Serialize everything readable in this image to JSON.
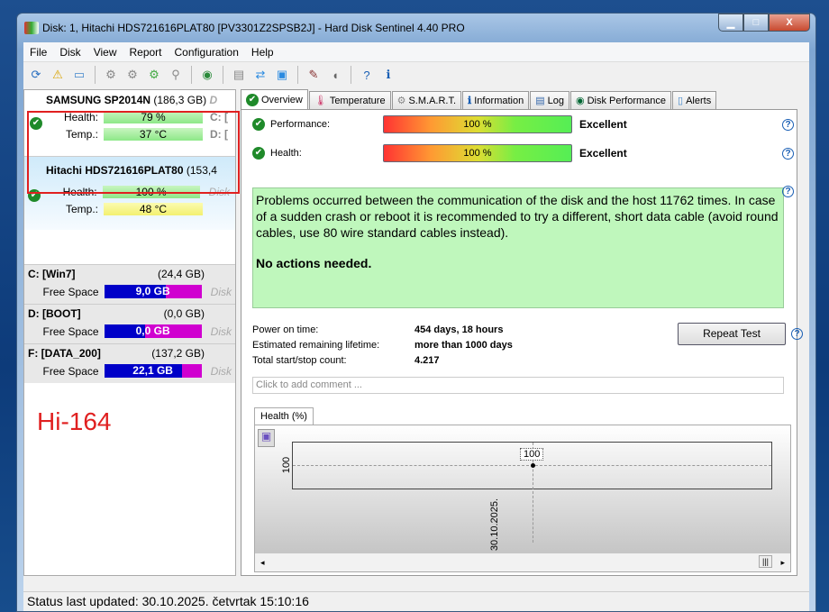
{
  "window": {
    "title": "Disk: 1, Hitachi HDS721616PLAT80 [PV3301Z2SPSB2J]  -  Hard Disk Sentinel 4.40 PRO",
    "min": "▁",
    "max": "□",
    "close": "X"
  },
  "menu": [
    "File",
    "Disk",
    "View",
    "Report",
    "Configuration",
    "Help"
  ],
  "disks": [
    {
      "name": "SAMSUNG SP2014N",
      "size": "(186,3 GB)",
      "health_label": "Health:",
      "health": "79 %",
      "health_pct": 79,
      "temp_label": "Temp.:",
      "temp": "37 °C",
      "side1": "C: [",
      "side2": "D: [",
      "tail": "D"
    },
    {
      "name": "Hitachi HDS721616PLAT80",
      "size": "(153,4",
      "health_label": "Health:",
      "health": "100 %",
      "health_pct": 100,
      "temp_label": "Temp.:",
      "temp": "48 °C",
      "side1": "Disk"
    }
  ],
  "volumes": [
    {
      "name": "C: [Win7]",
      "size": "(24,4 GB)",
      "label": "Free Space",
      "free": "9,0 GB",
      "used_pct": 63,
      "side": "Disk"
    },
    {
      "name": "D: [BOOT]",
      "size": "(0,0 GB)",
      "label": "Free Space",
      "free": "0,0 GB",
      "used_pct": 42,
      "side": "Disk"
    },
    {
      "name": "F: [DATA_200]",
      "size": "(137,2 GB)",
      "label": "Free Space",
      "free": "22,1 GB",
      "used_pct": 80,
      "side": "Disk"
    }
  ],
  "annotation": "Hi-164",
  "tabs": [
    "Overview",
    "Temperature",
    "S.M.A.R.T.",
    "Information",
    "Log",
    "Disk Performance",
    "Alerts"
  ],
  "overview": {
    "performance_label": "Performance:",
    "performance": "100 %",
    "performance_status": "Excellent",
    "health_label": "Health:",
    "health": "100 %",
    "health_status": "Excellent",
    "message": "Problems occurred between the communication of the disk and the host 11762 times. In case of a sudden crash or reboot it is recommended to try a different, short data cable (avoid round cables, use 80 wire standard cables instead).",
    "action": "No actions needed.",
    "power_on_label": "Power on time:",
    "power_on": "454 days, 18 hours",
    "lifetime_label": "Estimated remaining lifetime:",
    "lifetime": "more than 1000 days",
    "startstop_label": "Total start/stop count:",
    "startstop": "4.217",
    "repeat_test": "Repeat Test",
    "comment_placeholder": "Click to add comment ..."
  },
  "chart_data": {
    "type": "line",
    "title": "Health (%)",
    "x": [
      "30.10.2025."
    ],
    "values": [
      100
    ],
    "yticks": [
      "100"
    ],
    "data_labels": [
      "100"
    ]
  },
  "status": "Status last updated: 30.10.2025. četvrtak 15:10:16"
}
